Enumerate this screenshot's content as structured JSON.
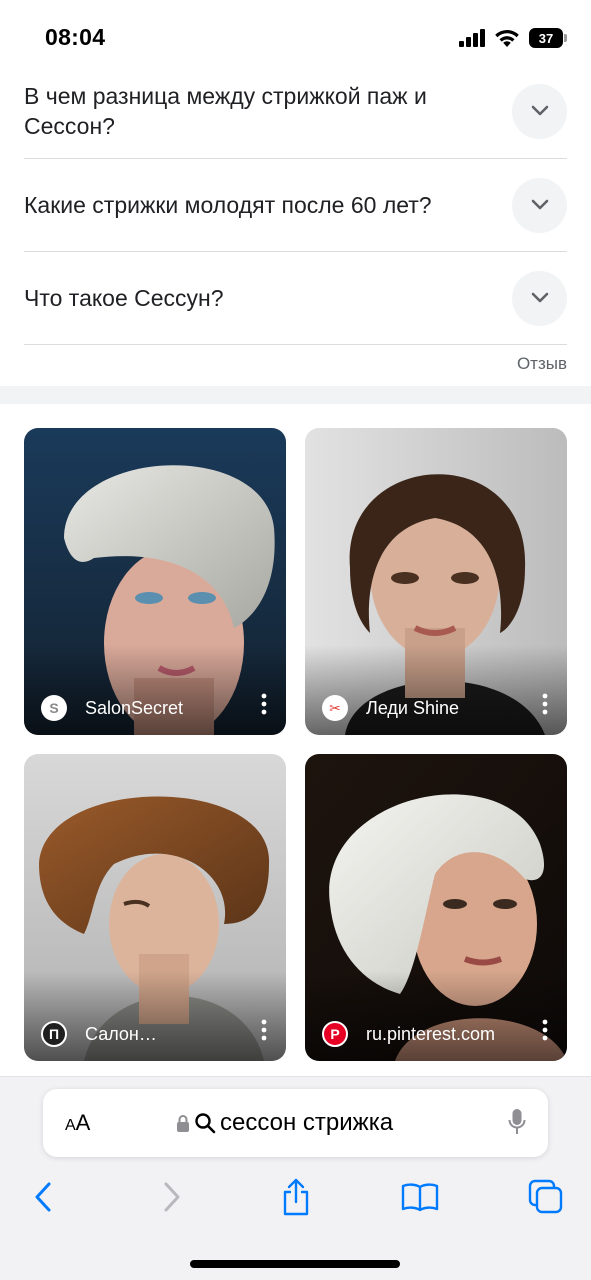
{
  "status_bar": {
    "time": "08:04",
    "battery": "37"
  },
  "faq": [
    {
      "question": "В чем разница между стрижкой паж и Сессон?"
    },
    {
      "question": "Какие стрижки молодят после 60 лет?"
    },
    {
      "question": "Что такое Сессун?"
    }
  ],
  "feedback": "Отзыв",
  "images": [
    {
      "source": "SalonSecret",
      "favicon_letter": "S",
      "favicon_color": "#ffffff"
    },
    {
      "source": "Леди Shine",
      "favicon_letter": "✂",
      "favicon_color": "#e53935"
    },
    {
      "source": "Салон…",
      "favicon_letter": "П",
      "favicon_color": "#1f1f1f"
    },
    {
      "source": "ru.pinterest.com",
      "favicon_letter": "P",
      "favicon_color": "#e60023"
    }
  ],
  "browser": {
    "text_size_label_small": "A",
    "text_size_label_large": "A",
    "url": "сессон стрижка"
  },
  "colors": {
    "accent": "#007aff",
    "divider": "#dadce0",
    "chip_bg": "#f1f3f4"
  }
}
